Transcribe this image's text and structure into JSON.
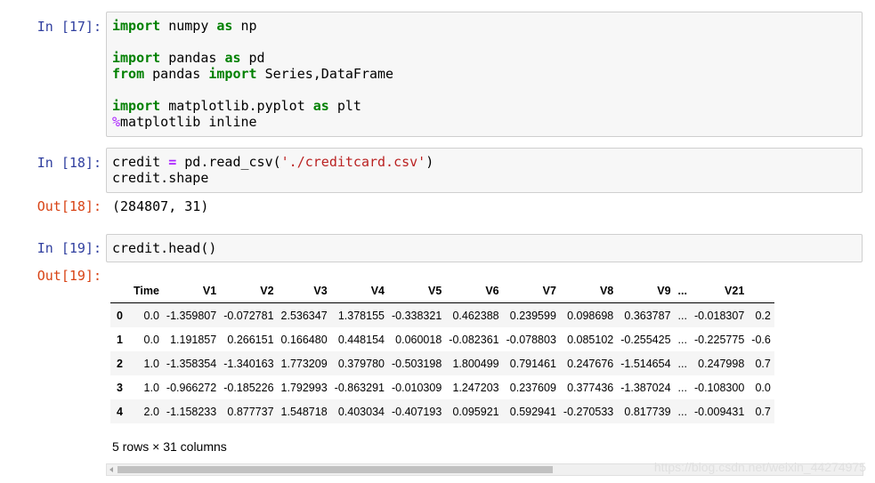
{
  "cells": [
    {
      "prompt": "In [17]:",
      "lines": [
        [
          {
            "t": "import",
            "c": "kw"
          },
          {
            "t": " numpy "
          },
          {
            "t": "as",
            "c": "kw"
          },
          {
            "t": " np"
          }
        ],
        [],
        [
          {
            "t": "import",
            "c": "kw"
          },
          {
            "t": " pandas "
          },
          {
            "t": "as",
            "c": "kw"
          },
          {
            "t": " pd"
          }
        ],
        [
          {
            "t": "from",
            "c": "kw"
          },
          {
            "t": " pandas "
          },
          {
            "t": "import",
            "c": "kw"
          },
          {
            "t": " Series,DataFrame"
          }
        ],
        [],
        [
          {
            "t": "import",
            "c": "kw"
          },
          {
            "t": " matplotlib.pyplot "
          },
          {
            "t": "as",
            "c": "kw"
          },
          {
            "t": " plt"
          }
        ],
        [
          {
            "t": "%",
            "c": "mg"
          },
          {
            "t": "matplotlib inline"
          }
        ]
      ]
    },
    {
      "prompt": "In [18]:",
      "lines": [
        [
          {
            "t": "credit "
          },
          {
            "t": "=",
            "c": "op"
          },
          {
            "t": " pd.read_csv("
          },
          {
            "t": "'./creditcard.csv'",
            "c": "str"
          },
          {
            "t": ")"
          }
        ],
        [
          {
            "t": "credit.shape"
          }
        ]
      ],
      "out_prompt": "Out[18]:",
      "output": "(284807, 31)"
    },
    {
      "prompt": "In [19]:",
      "lines": [
        [
          {
            "t": "credit.head()"
          }
        ]
      ],
      "out_prompt": "Out[19]:"
    }
  ],
  "dataframe": {
    "columns": [
      "",
      "Time",
      "V1",
      "V2",
      "V3",
      "V4",
      "V5",
      "V6",
      "V7",
      "V8",
      "V9",
      "...",
      "V21",
      ""
    ],
    "rows": [
      [
        "0",
        "0.0",
        "-1.359807",
        "-0.072781",
        "2.536347",
        "1.378155",
        "-0.338321",
        "0.462388",
        "0.239599",
        "0.098698",
        "0.363787",
        "...",
        "-0.018307",
        "0.2"
      ],
      [
        "1",
        "0.0",
        "1.191857",
        "0.266151",
        "0.166480",
        "0.448154",
        "0.060018",
        "-0.082361",
        "-0.078803",
        "0.085102",
        "-0.255425",
        "...",
        "-0.225775",
        "-0.6"
      ],
      [
        "2",
        "1.0",
        "-1.358354",
        "-1.340163",
        "1.773209",
        "0.379780",
        "-0.503198",
        "1.800499",
        "0.791461",
        "0.247676",
        "-1.514654",
        "...",
        "0.247998",
        "0.7"
      ],
      [
        "3",
        "1.0",
        "-0.966272",
        "-0.185226",
        "1.792993",
        "-0.863291",
        "-0.010309",
        "1.247203",
        "0.237609",
        "0.377436",
        "-1.387024",
        "...",
        "-0.108300",
        "0.0"
      ],
      [
        "4",
        "2.0",
        "-1.158233",
        "0.877737",
        "1.548718",
        "0.403034",
        "-0.407193",
        "0.095921",
        "0.592941",
        "-0.270533",
        "0.817739",
        "...",
        "-0.009431",
        "0.7"
      ]
    ],
    "caption": "5 rows × 31 columns"
  },
  "watermark": "https://blog.csdn.net/weixin_44274975"
}
